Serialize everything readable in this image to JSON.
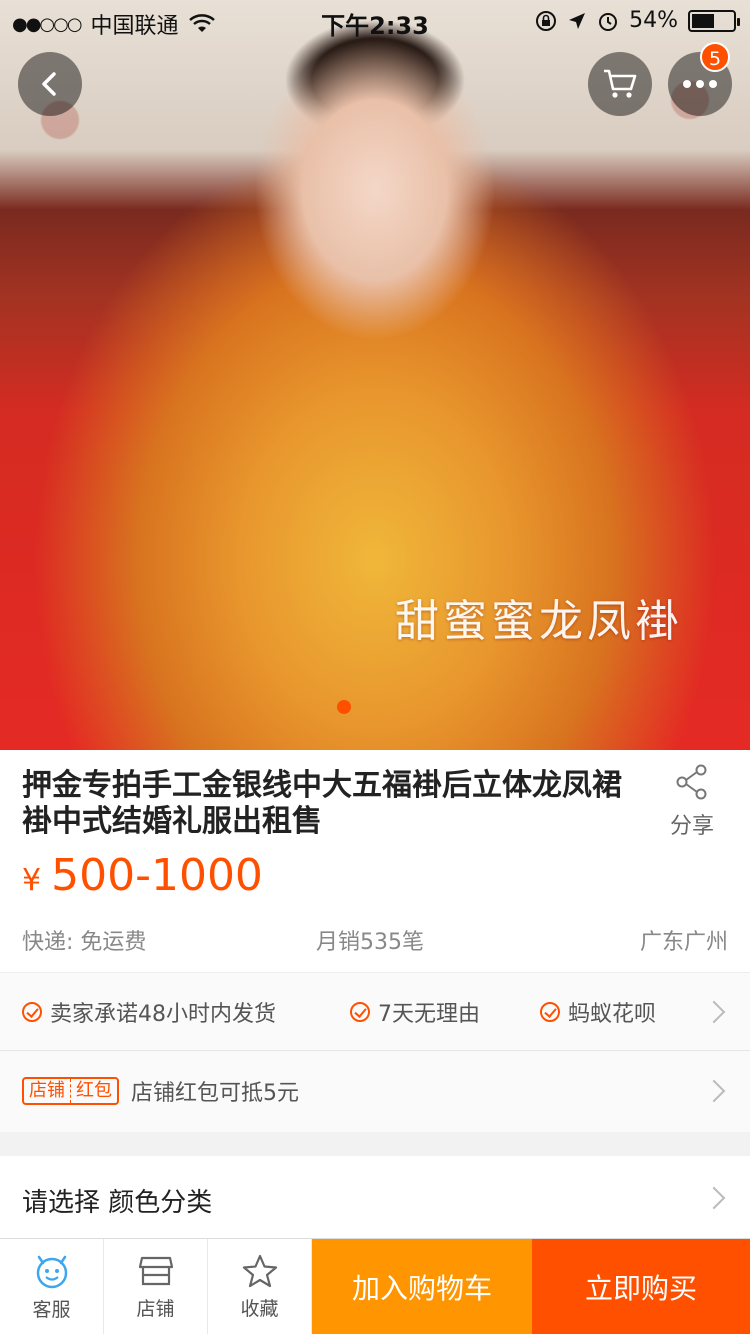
{
  "status_bar": {
    "signal": "●●○○○",
    "carrier": "中国联通",
    "time": "下午2:33",
    "battery": "54%",
    "battery_level": 0.54
  },
  "nav": {
    "cart_badge": "5"
  },
  "hero": {
    "watermark": "甜蜜蜜龙凤褂"
  },
  "product": {
    "title": "押金专拍手工金银线中大五福褂后立体龙凤裙褂中式结婚礼服出租售",
    "share_label": "分享",
    "currency": "¥",
    "price": "500-1000",
    "shipping": "快递: 免运费",
    "monthly_sales": "月销535笔",
    "location": "广东广州"
  },
  "services": {
    "items": [
      "卖家承诺48小时内发货",
      "7天无理由",
      "蚂蚁花呗"
    ],
    "coupon_tag": [
      "店铺",
      "红包"
    ],
    "coupon_text": "店铺红包可抵5元"
  },
  "select": {
    "label": "请选择 颜色分类"
  },
  "bottom_bar": {
    "service": "客服",
    "store": "店铺",
    "favorite": "收藏",
    "add_to_cart": "加入购物车",
    "buy_now": "立即购买"
  },
  "colors": {
    "accent": "#ff5000",
    "cart_button": "#ff9500"
  },
  "icons": [
    "back-arrow-icon",
    "cart-icon",
    "more-icon",
    "wifi-icon",
    "share-icon",
    "customer-service-icon",
    "store-icon",
    "star-icon"
  ]
}
